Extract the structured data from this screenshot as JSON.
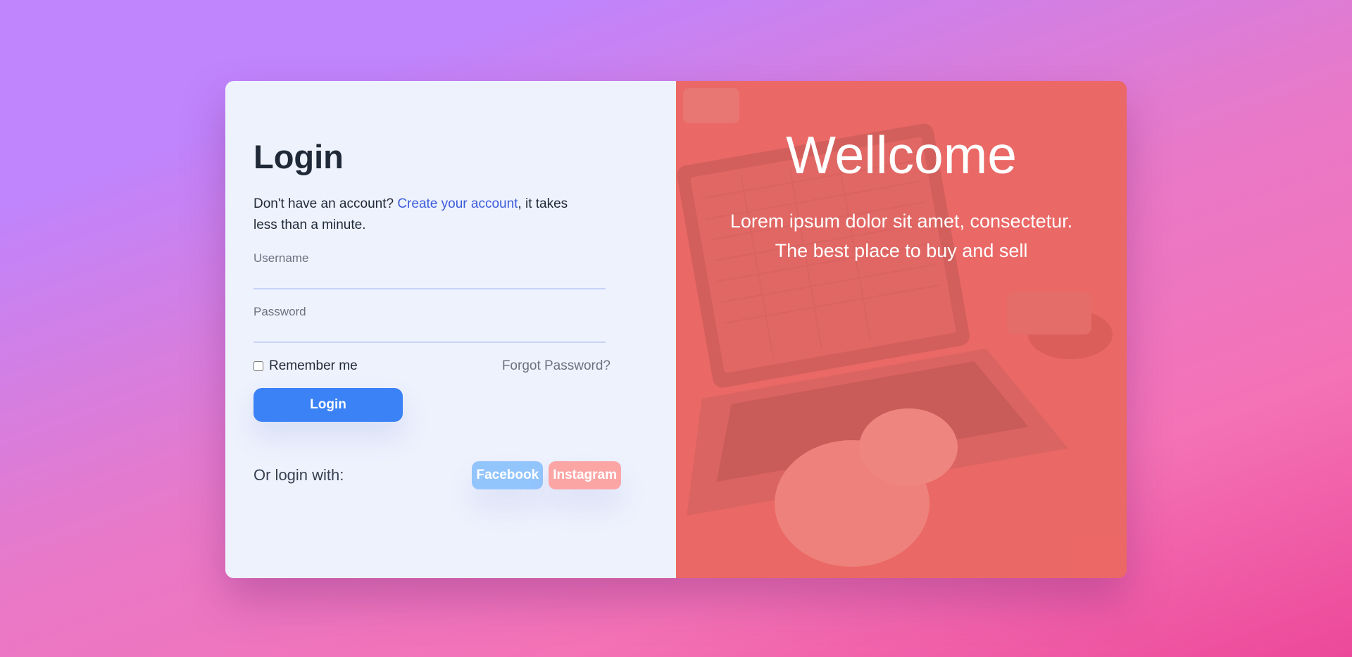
{
  "login": {
    "title": "Login",
    "intro_prefix": "Don't have an account? ",
    "create_link": "Create your account",
    "intro_suffix": ", it takes less than a minute.",
    "username_label": "Username",
    "username_value": "",
    "password_label": "Password",
    "password_value": "",
    "remember_label": "Remember me",
    "forgot_label": "Forgot Password?",
    "submit_label": "Login",
    "social_label": "Or login with:",
    "facebook_label": "Facebook",
    "instagram_label": "Instagram"
  },
  "hero": {
    "title": "Wellcome",
    "line1": "Lorem ipsum dolor sit amet, consectetur.",
    "line2": "The best place to buy and sell"
  },
  "colors": {
    "primary": "#3b82f6",
    "hero_overlay": "#f2716f",
    "facebook": "#93c5fd",
    "instagram": "#fca5a5"
  }
}
